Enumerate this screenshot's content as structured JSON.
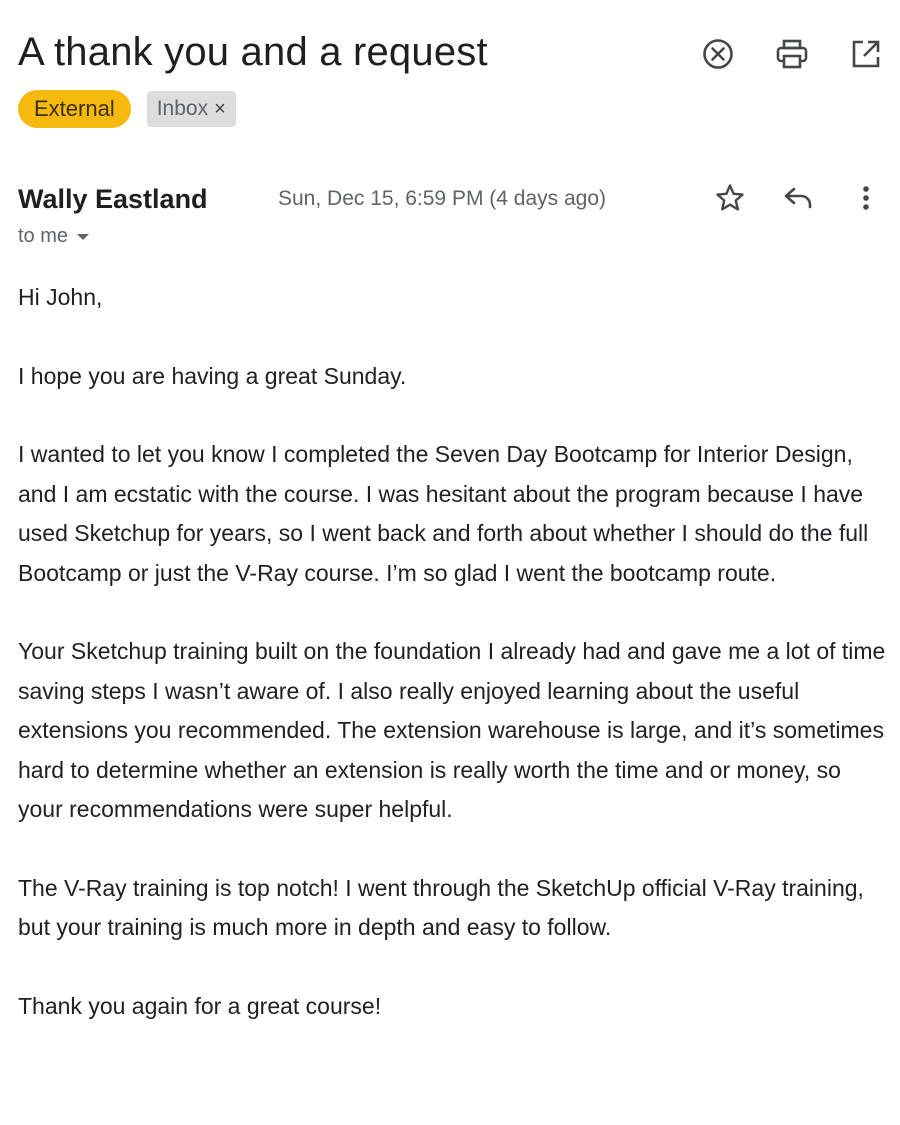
{
  "email": {
    "subject": "A thank you and a request",
    "labels": {
      "external": "External",
      "inbox": "Inbox",
      "remove_symbol": "×"
    },
    "sender": {
      "name": "Wally Eastland",
      "timestamp": "Sun, Dec 15, 6:59 PM (4 days ago)",
      "recipient": "to me"
    },
    "body": [
      "Hi John,",
      "I hope you are having a great Sunday.",
      "I wanted to let you know I completed the Seven Day Bootcamp for Interior Design, and I am ecstatic with the course. I was hesitant about the program because I have used Sketchup for years, so I went back and forth about whether I should do the full Bootcamp or just the V-Ray course. I’m so glad I went the bootcamp route.",
      "Your Sketchup training built on the foundation I already had and gave me a lot of time saving steps I wasn’t aware of. I also really enjoyed learning about the useful extensions you recommended. The extension warehouse is large, and it’s sometimes hard to determine whether an extension is really worth the time and or money, so your recommendations were super helpful.",
      "The V-Ray training is top notch! I went through the SketchUp official V-Ray training, but your training is much more in depth and easy to follow.",
      "Thank you again for a great course!"
    ]
  },
  "icons": {
    "header": [
      "close-circle-icon",
      "print-icon",
      "open-in-new-window-icon"
    ],
    "message": [
      "star-icon",
      "reply-icon",
      "more-vert-icon"
    ],
    "recipient": "chevron-down-icon"
  },
  "colors": {
    "external_label": "#f6b90d",
    "inbox_label": "#dddddd",
    "secondary_text": "#5f6368",
    "primary_text": "#202124"
  }
}
